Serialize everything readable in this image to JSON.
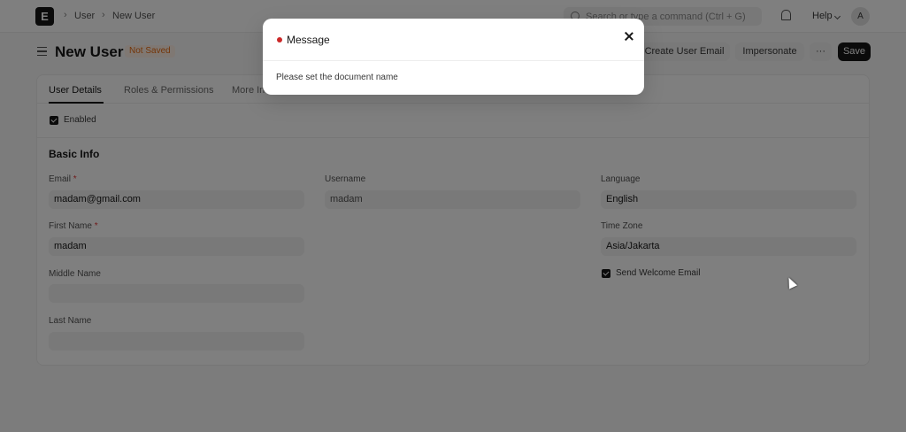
{
  "navbar": {
    "logo_letter": "E",
    "breadcrumbs": [
      "User",
      "New User"
    ],
    "breadcrumb_sep": "›",
    "search_placeholder": "Search or type a command (Ctrl + G)",
    "help_label": "Help",
    "avatar_letter": "A"
  },
  "page": {
    "title": "New User",
    "status_badge": "Not Saved",
    "actions": {
      "create_user_email": "Create User Email",
      "impersonate": "Impersonate",
      "more": "···",
      "save": "Save"
    }
  },
  "tabs": [
    "User Details",
    "Roles & Permissions",
    "More Info"
  ],
  "enabled_label": "Enabled",
  "basic_info": {
    "section_title": "Basic Info",
    "email_label": "Email",
    "email_value": "madam@gmail.com",
    "first_name_label": "First Name",
    "first_name_value": "madam",
    "middle_name_label": "Middle Name",
    "middle_name_value": "",
    "last_name_label": "Last Name",
    "last_name_value": "",
    "username_label": "Username",
    "username_value": "madam",
    "language_label": "Language",
    "language_value": "English",
    "time_zone_label": "Time Zone",
    "time_zone_value": "Asia/Jakarta",
    "send_welcome_label": "Send Welcome Email",
    "required_mark": "*"
  },
  "modal": {
    "title": "Message",
    "body": "Please set the document name"
  },
  "colors": {
    "indicator_red": "#cc2929",
    "badge_orange": "#e86c13",
    "primary": "#171717"
  }
}
